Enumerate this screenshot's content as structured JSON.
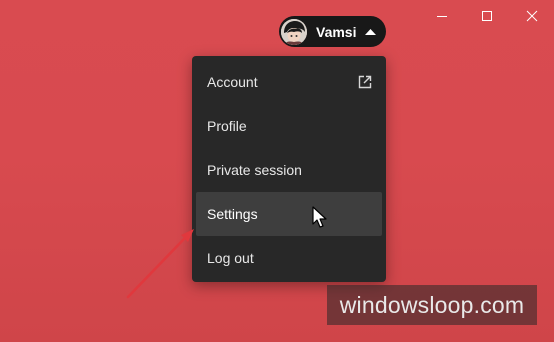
{
  "user": {
    "name": "Vamsi"
  },
  "menu": {
    "items": [
      {
        "label": "Account",
        "icon": "external-link-icon"
      },
      {
        "label": "Profile"
      },
      {
        "label": "Private session"
      },
      {
        "label": "Settings",
        "hovered": true
      },
      {
        "label": "Log out"
      }
    ]
  },
  "watermark": {
    "text": "windowsloop.com"
  },
  "colors": {
    "background": "#d94b50",
    "menu_bg": "#282828",
    "menu_hover": "#3e3e3e",
    "annotation_arrow": "#e0383d"
  }
}
